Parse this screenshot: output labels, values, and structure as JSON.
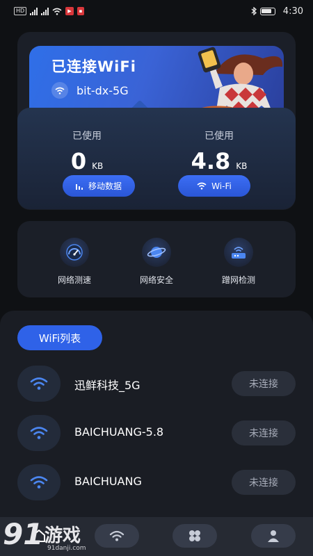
{
  "status_bar": {
    "left_chips": [
      "HD",
      "2",
      "46",
      "HD"
    ],
    "time": "4:30"
  },
  "banner": {
    "title": "已连接WiFi",
    "ssid": "bit-dx-5G"
  },
  "stats": {
    "mobile": {
      "label": "已使用",
      "value": "0",
      "unit": "KB",
      "button": "移动数据"
    },
    "wifi": {
      "label": "已使用",
      "value": "4.8",
      "unit": "KB",
      "button": "Wi-Fi"
    }
  },
  "tools": [
    {
      "label": "网络测速",
      "icon": "speedometer-icon"
    },
    {
      "label": "网络安全",
      "icon": "planet-icon"
    },
    {
      "label": "蹭网检测",
      "icon": "router-icon"
    }
  ],
  "wifi_list": {
    "tab_label": "WiFi列表",
    "networks": [
      {
        "name": "迅鲜科技_5G",
        "status": "未连接"
      },
      {
        "name": "BAICHUANG-5.8",
        "status": "未连接"
      },
      {
        "name": "BAICHUANG",
        "status": "未连接"
      }
    ]
  },
  "bottom_nav": {
    "items": [
      "home-icon",
      "wifi-icon",
      "apps-icon",
      "profile-icon"
    ]
  },
  "watermark": {
    "number": "91",
    "text": "游戏",
    "sub": "91danji.com"
  },
  "colors": {
    "accent": "#2f62e8",
    "background": "#0f1114",
    "card": "#1b1f28"
  }
}
